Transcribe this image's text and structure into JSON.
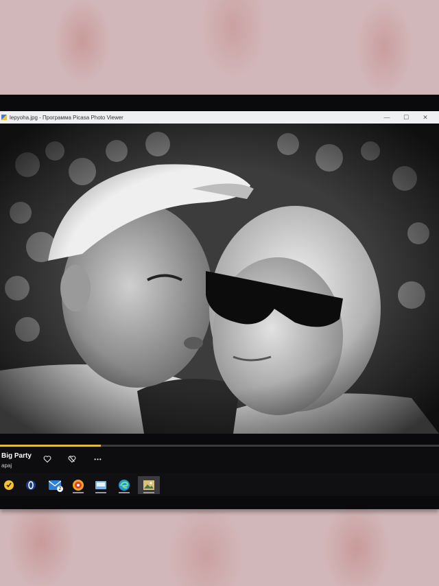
{
  "window": {
    "title": "lepyoha.jpg - Программа Picasa Photo Viewer",
    "controls": {
      "minimize": "—",
      "maximize": "☐",
      "close": "✕"
    }
  },
  "media": {
    "progress": 0.23,
    "track_title": "Big Party",
    "artist": "apaj",
    "like_icon": "heart-icon",
    "dislike_icon": "heart-crossed-icon",
    "more_label": "•••",
    "accent": "#e8b838"
  },
  "taskbar": {
    "items": [
      {
        "name": "norton-icon"
      },
      {
        "name": "opera-gx-icon"
      },
      {
        "name": "mail-icon",
        "badge": "2"
      },
      {
        "name": "music-app-icon"
      },
      {
        "name": "file-manager-icon"
      },
      {
        "name": "edge-icon"
      },
      {
        "name": "photo-viewer-icon"
      }
    ]
  }
}
